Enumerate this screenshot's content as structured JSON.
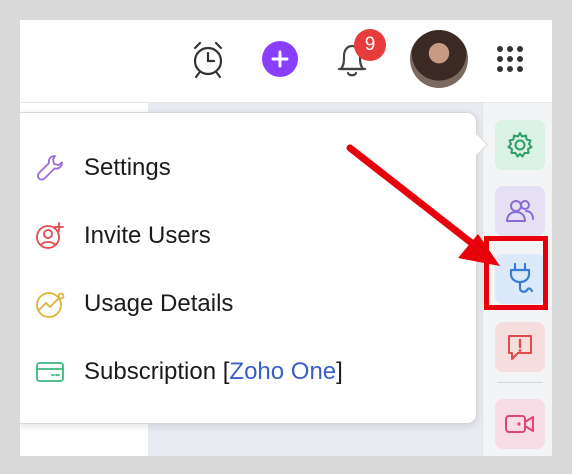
{
  "header": {
    "notification_count": "9",
    "icons": [
      "alarm-clock-icon",
      "plus-icon",
      "bell-icon",
      "avatar",
      "apps-grid-icon"
    ],
    "colors": {
      "plus": "#8a3ffc",
      "badge": "#e83b3b"
    }
  },
  "menu": {
    "items": [
      {
        "label": "Settings",
        "icon": "wrench-icon",
        "color": "#9b6bd6"
      },
      {
        "label": "Invite Users",
        "icon": "add-user-icon",
        "color": "#e04a4a"
      },
      {
        "label": "Usage Details",
        "icon": "trend-chart-icon",
        "color": "#e0b23a"
      },
      {
        "label": "Subscription",
        "bracket_open": "[",
        "plan": "Zoho One",
        "bracket_close": "]",
        "icon": "card-icon",
        "color": "#3bb77e"
      }
    ]
  },
  "sidebar": {
    "items": [
      {
        "icon": "gear-icon",
        "color": "#2e9e68",
        "bg": "#d9f2e4"
      },
      {
        "icon": "users-icon",
        "color": "#8a6ad6",
        "bg": "#e6e0f5"
      },
      {
        "icon": "plug-icon",
        "color": "#3a7bd5",
        "bg": "#dbe9fb"
      },
      {
        "icon": "report-issue-icon",
        "color": "#e04a4a",
        "bg": "#f7dede"
      },
      {
        "icon": "video-icon",
        "color": "#e0457b",
        "bg": "#f8dde6"
      }
    ]
  },
  "annotation": {
    "highlight_color": "#e8000b"
  }
}
